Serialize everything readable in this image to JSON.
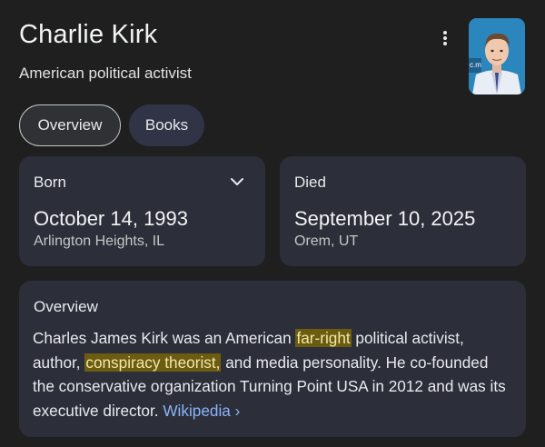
{
  "header": {
    "title": "Charlie Kirk",
    "subtitle": "American political activist"
  },
  "tabs": [
    {
      "label": "Overview",
      "selected": true
    },
    {
      "label": "Books",
      "selected": false
    }
  ],
  "born": {
    "label": "Born",
    "date": "October 14, 1993",
    "place": "Arlington Heights, IL"
  },
  "died": {
    "label": "Died",
    "date": "September 10, 2025",
    "place": "Orem, UT"
  },
  "overview": {
    "label": "Overview",
    "text_part1": "Charles James Kirk was an American ",
    "highlight1": "far-right",
    "text_part2": " political activist, author, ",
    "highlight2": "conspiracy theorist,",
    "text_part3": " and media personality. He co-founded the conservative organization Turning Point USA in 2012 and was its executive director. ",
    "source_link": "Wikipedia",
    "source_chevron": "›"
  },
  "colors": {
    "background": "#1f1f1f",
    "card": "#2c2f3a",
    "highlight": "#6b5c12",
    "link": "#8ab4f8"
  }
}
